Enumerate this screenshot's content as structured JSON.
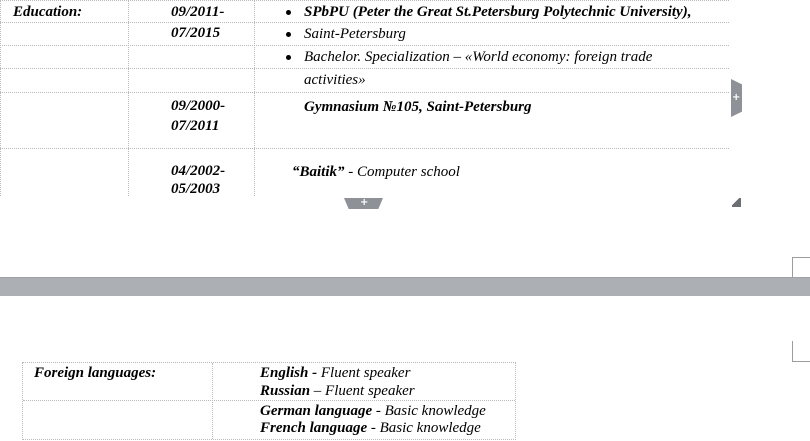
{
  "education": {
    "label": "Education:",
    "rows": [
      {
        "period": [
          "09/2011-",
          "07/2015"
        ],
        "lines": [
          "SPbPU (Peter the Great St.Petersburg Polytechnic University),",
          "Saint-Petersburg",
          "Bachelor. Specialization – «World economy: foreign trade",
          "activities»"
        ]
      },
      {
        "period": [
          "09/2000-",
          "07/2011"
        ],
        "lines": [
          "Gymnasium №105, Saint-Petersburg"
        ]
      },
      {
        "period": [
          "04/2002-",
          "05/2003"
        ],
        "bold": "“Baitik”",
        "rest": " - Computer school"
      }
    ]
  },
  "languages": {
    "label": "Foreign languages:",
    "rows": [
      [
        {
          "name": "English -",
          "level": " Fluent speaker"
        },
        {
          "name": "Russian",
          "level": " – Fluent speaker"
        }
      ],
      [
        {
          "name": "German language",
          "level": " - Basic knowledge"
        },
        {
          "name": "French language",
          "level": " - Basic knowledge"
        }
      ]
    ]
  },
  "controls": {
    "add_row": "+",
    "add_column": "+"
  },
  "colors": {
    "page_gap": "#acafb4",
    "handle": "#8e9297",
    "gridline": "#b9b9b9"
  }
}
